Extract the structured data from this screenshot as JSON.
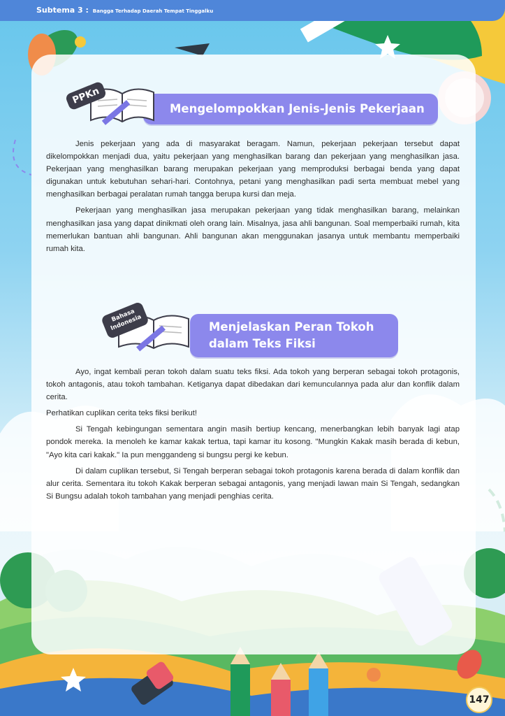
{
  "header": {
    "subtema_label": "Subtema 3 :",
    "subtema_title": "Bangga Terhadap Daerah Tempat Tinggalku"
  },
  "section1": {
    "subject_tag": "PPKn",
    "title": "Mengelompokkan Jenis-Jenis Pekerjaan",
    "paragraphs": [
      "Jenis pekerjaan yang ada di masyarakat beragam. Namun, pekerjaan pekerjaan tersebut dapat dikelompokkan menjadi dua, yaitu pekerjaan yang menghasilkan barang dan pekerjaan yang menghasilkan jasa. Pekerjaan yang menghasilkan barang merupakan pekerjaan yang memproduksi berbagai benda yang dapat digunakan untuk kebutuhan sehari-hari. Contohnya, petani yang menghasilkan padi serta membuat mebel yang menghasilkan berbagai peralatan rumah tangga berupa kursi dan meja.",
      "Pekerjaan yang menghasilkan jasa merupakan pekerjaan yang tidak menghasilkan barang, melainkan menghasilkan jasa yang dapat dinikmati oleh orang lain. Misalnya, jasa ahli bangunan. Soal memperbaiki rumah, kita memerlukan bantuan ahli bangunan. Ahli bangunan akan menggunakan jasanya untuk membantu memperbaiki rumah kita."
    ]
  },
  "section2": {
    "subject_tag_line1": "Bahasa",
    "subject_tag_line2": "Indonesia",
    "title_line1": "Menjelaskan Peran Tokoh",
    "title_line2": "dalam Teks Fiksi",
    "paragraph1": "Ayo, ingat kembali peran tokoh dalam suatu teks fiksi. Ada tokoh yang berperan sebagai tokoh protagonis, tokoh antagonis, atau tokoh tambahan. Ketiganya dapat dibedakan dari kemunculannya pada alur dan konflik dalam cerita.",
    "instruction": "Perhatikan cuplikan cerita teks fiksi berikut!",
    "quote": "Si Tengah kebingungan sementara angin masih bertiup kencang, menerbangkan lebih banyak lagi atap pondok mereka. Ia menoleh ke kamar kakak tertua, tapi kamar itu kosong. \"Mungkin Kakak masih berada di kebun, \"Ayo kita cari kakak.\" Ia pun menggandeng si bungsu pergi ke kebun.",
    "explanation": "Di dalam cuplikan tersebut, Si Tengah berperan sebagai tokoh protagonis karena berada di dalam konflik dan alur cerita. Sementara itu tokoh Kakak berperan sebagai antagonis, yang menjadi lawan main Si Tengah, sedangkan Si Bungsu adalah tokoh tambahan yang menjadi penghias cerita."
  },
  "footer": {
    "page_number": "147"
  },
  "colors": {
    "header_bar": "#4f86d9",
    "title_banner": "#8c88ec",
    "subject_tag": "#3d3d4a"
  }
}
